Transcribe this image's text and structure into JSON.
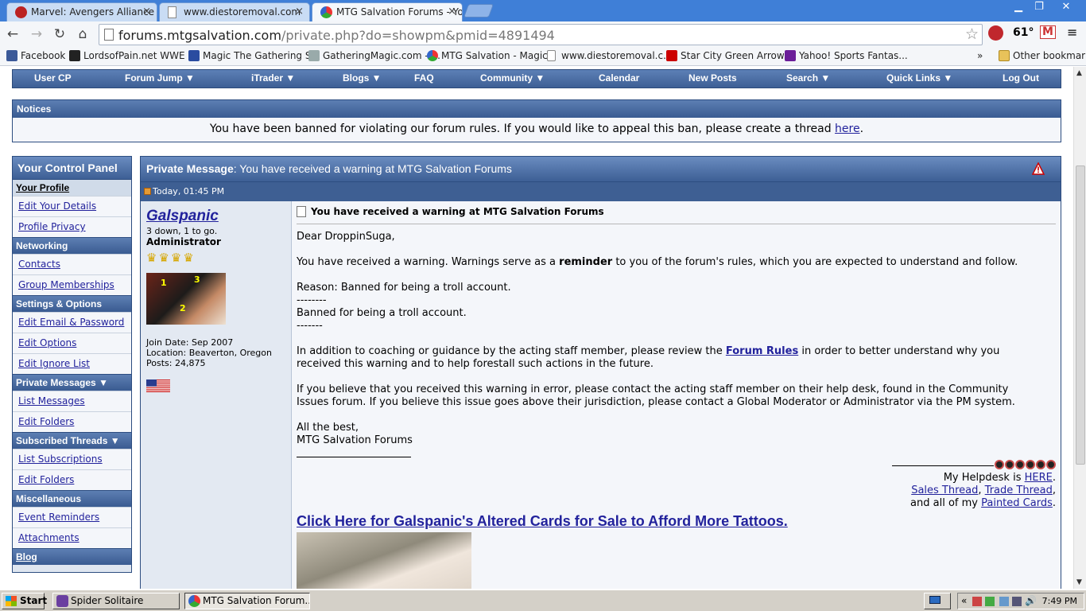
{
  "browser": {
    "tabs": [
      {
        "title": "Marvel: Avengers Alliance on",
        "active": false
      },
      {
        "title": "www.diestoremoval.com",
        "active": false
      },
      {
        "title": "MTG Salvation Forums - You",
        "active": true
      }
    ],
    "close_glyph": "×",
    "url_host": "forums.mtgsalvation.com",
    "url_path": "/private.php?do=showpm&pmid=4891494",
    "weather_temp": "61°",
    "overflow_glyph": "»",
    "bookmarks": [
      "Facebook",
      "LordsofPain.net WWE ...",
      "Magic The Gathering S...",
      "GatheringMagic.com - ...",
      "MTG Salvation - Magic...",
      "www.diestoremoval.c...",
      "Star City Green Arrow...",
      "Yahoo! Sports Fantas..."
    ],
    "other_bookmarks": "Other bookmarks"
  },
  "forum_nav": {
    "items": [
      "User CP",
      "Forum Jump ▼",
      "iTrader ▼",
      "Blogs ▼",
      "FAQ",
      "Community ▼",
      "Calendar",
      "New Posts",
      "Search ▼",
      "Quick Links ▼",
      "Log Out"
    ]
  },
  "notices": {
    "header": "Notices",
    "text": "You have been banned for violating our forum rules. If you would like to appeal this ban, please create a thread ",
    "link": "here",
    "end": "."
  },
  "control_panel": {
    "title": "Your Control Panel",
    "your_profile": "Your Profile",
    "edit_details": "Edit Your Details",
    "profile_privacy": "Profile Privacy",
    "networking": "Networking",
    "contacts": "Contacts",
    "group_memberships": "Group Memberships",
    "settings_options": "Settings & Options",
    "edit_email": "Edit Email & Password",
    "edit_options": "Edit Options",
    "edit_ignore": "Edit Ignore List",
    "private_messages": "Private Messages ▼",
    "list_messages": "List Messages",
    "edit_folders_pm": "Edit Folders",
    "subscribed_threads": "Subscribed Threads ▼",
    "list_subscriptions": "List Subscriptions",
    "edit_folders_sub": "Edit Folders",
    "misc": "Miscellaneous",
    "event_reminders": "Event Reminders",
    "attachments": "Attachments",
    "blog": "Blog"
  },
  "pm": {
    "header_label": "Private Message",
    "header_subject": ": You have received a warning at MTG Salvation Forums",
    "date": "Today, 01:45 PM",
    "author": {
      "name": "Galspanic",
      "title": "3 down, 1 to go.",
      "rank": "Administrator",
      "trophy_count": 4,
      "join_date": "Join Date: Sep 2007",
      "location": "Location: Beaverton, Oregon",
      "posts": "Posts: 24,875",
      "avatar_labels": [
        "1",
        "3",
        "2"
      ]
    },
    "subject": "You have received a warning at MTG Salvation Forums",
    "greeting": "Dear DroppinSuga,",
    "warn_pre": "You have received a warning. Warnings serve as a ",
    "warn_bold": "reminder",
    "warn_post": " to you of the forum's rules, which you are expected to understand and follow.",
    "reason": "Reason: Banned for being a troll account.",
    "dashes1": "--------",
    "reason2": "Banned for being a troll account.",
    "dashes2": "-------",
    "coach_pre": "In addition to coaching or guidance by the acting staff member, please review the ",
    "coach_link": "Forum Rules",
    "coach_post": " in order to better understand why you",
    "coach_line2": "received this warning and to help forestall such actions in the future.",
    "error_line1": "If you believe that you received this warning in error, please contact the acting staff member on their help desk, found in the Community",
    "error_line2": "Issues forum. If you believe this issue goes above their jurisdiction, please contact a Global Moderator or Administrator via the PM system.",
    "closing1": "All the best,",
    "closing2": "MTG Salvation Forums",
    "sig": {
      "helpdesk_pre": "My Helpdesk is ",
      "helpdesk_link": "HERE",
      "helpdesk_end": ".",
      "sales": "Sales Thread",
      "comma": ", ",
      "trade": "Trade Thread",
      "trade_end": ",",
      "painted_pre": "and all of my ",
      "painted_link": "Painted Cards",
      "painted_end": ".",
      "big_link": "Click Here for Galspanic's Altered Cards for Sale to Afford More Tattoos."
    }
  },
  "taskbar": {
    "start": "Start",
    "tasks": [
      "Spider Solitaire",
      "MTG Salvation Forum..."
    ],
    "tray_chevron": "«",
    "clock": "7:49 PM"
  }
}
